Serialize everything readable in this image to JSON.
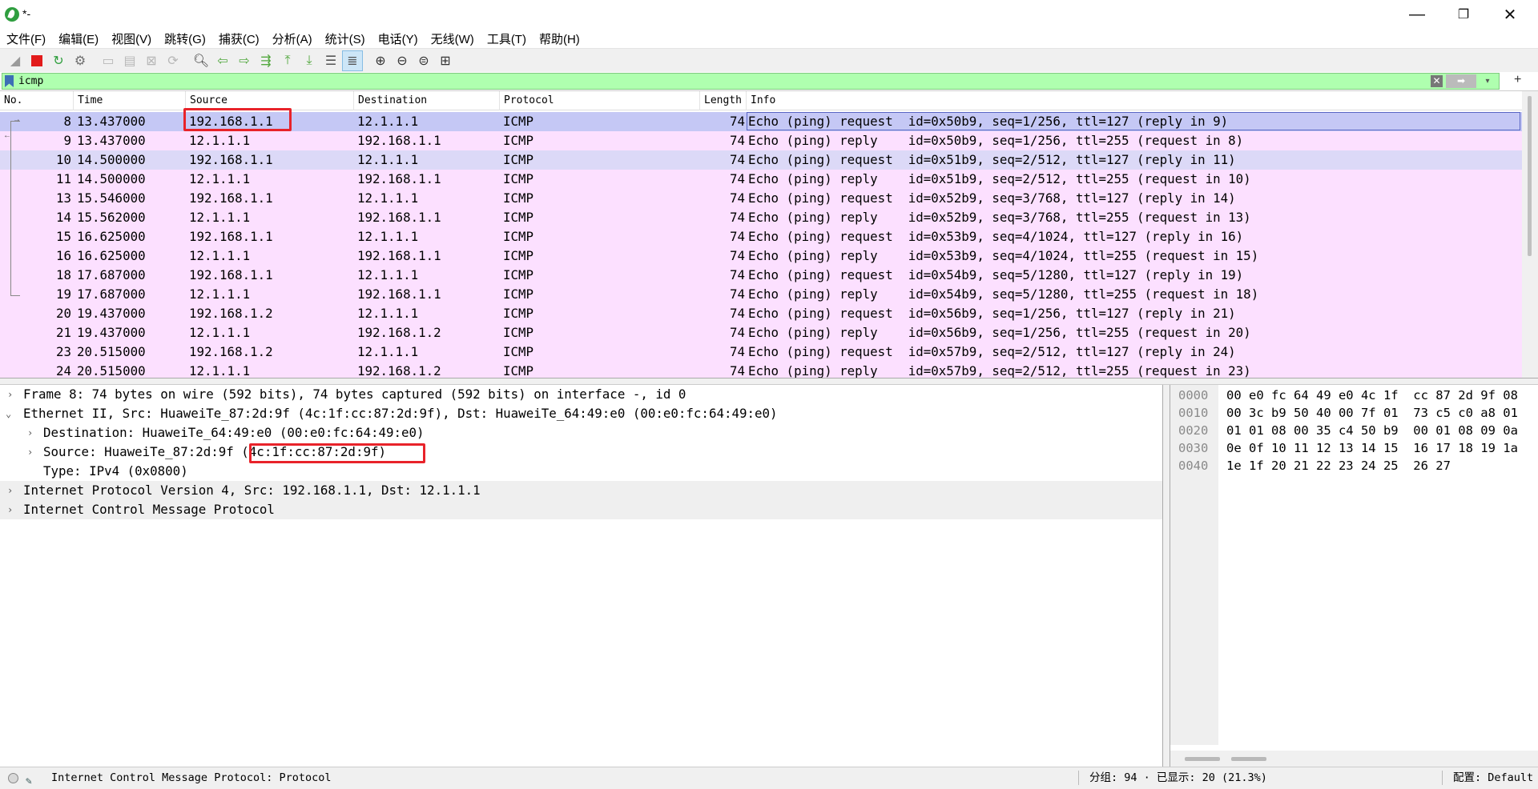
{
  "window": {
    "title": "*-",
    "minimize_glyph": "—",
    "maximize_glyph": "❐",
    "close_glyph": "✕"
  },
  "menu": [
    "文件(F)",
    "编辑(E)",
    "视图(V)",
    "跳转(G)",
    "捕获(C)",
    "分析(A)",
    "统计(S)",
    "电话(Y)",
    "无线(W)",
    "工具(T)",
    "帮助(H)"
  ],
  "toolbar": {
    "icons": [
      "shark-start-icon",
      "stop-capture-icon",
      "restart-capture-icon",
      "capture-options-icon",
      "open-file-icon",
      "save-file-icon",
      "close-file-icon",
      "reload-file-icon",
      "find-packet-icon",
      "go-back-icon",
      "go-forward-icon",
      "go-to-packet-icon",
      "go-first-icon",
      "go-last-icon",
      "autoscroll-icon",
      "colorize-icon",
      "zoom-in-icon",
      "zoom-out-icon",
      "zoom-normal-icon",
      "resize-columns-icon"
    ]
  },
  "filter": {
    "value": "icmp",
    "clear_glyph": "✕",
    "apply_glyph": "➡",
    "dropdown_glyph": "▾",
    "add_glyph": "+"
  },
  "packet_list": {
    "columns": [
      "No.",
      "Time",
      "Source",
      "Destination",
      "Protocol",
      "Length",
      "Info"
    ],
    "rows": [
      {
        "no": "8",
        "time": "13.437000",
        "source": "192.168.1.1",
        "destination": "12.1.1.1",
        "protocol": "ICMP",
        "length": "74",
        "info": "Echo (ping) request  id=0x50b9, seq=1/256, ttl=127 (reply in 9)"
      },
      {
        "no": "9",
        "time": "13.437000",
        "source": "12.1.1.1",
        "destination": "192.168.1.1",
        "protocol": "ICMP",
        "length": "74",
        "info": "Echo (ping) reply    id=0x50b9, seq=1/256, ttl=255 (request in 8)"
      },
      {
        "no": "10",
        "time": "14.500000",
        "source": "192.168.1.1",
        "destination": "12.1.1.1",
        "protocol": "ICMP",
        "length": "74",
        "info": "Echo (ping) request  id=0x51b9, seq=2/512, ttl=127 (reply in 11)"
      },
      {
        "no": "11",
        "time": "14.500000",
        "source": "12.1.1.1",
        "destination": "192.168.1.1",
        "protocol": "ICMP",
        "length": "74",
        "info": "Echo (ping) reply    id=0x51b9, seq=2/512, ttl=255 (request in 10)"
      },
      {
        "no": "13",
        "time": "15.546000",
        "source": "192.168.1.1",
        "destination": "12.1.1.1",
        "protocol": "ICMP",
        "length": "74",
        "info": "Echo (ping) request  id=0x52b9, seq=3/768, ttl=127 (reply in 14)"
      },
      {
        "no": "14",
        "time": "15.562000",
        "source": "12.1.1.1",
        "destination": "192.168.1.1",
        "protocol": "ICMP",
        "length": "74",
        "info": "Echo (ping) reply    id=0x52b9, seq=3/768, ttl=255 (request in 13)"
      },
      {
        "no": "15",
        "time": "16.625000",
        "source": "192.168.1.1",
        "destination": "12.1.1.1",
        "protocol": "ICMP",
        "length": "74",
        "info": "Echo (ping) request  id=0x53b9, seq=4/1024, ttl=127 (reply in 16)"
      },
      {
        "no": "16",
        "time": "16.625000",
        "source": "12.1.1.1",
        "destination": "192.168.1.1",
        "protocol": "ICMP",
        "length": "74",
        "info": "Echo (ping) reply    id=0x53b9, seq=4/1024, ttl=255 (request in 15)"
      },
      {
        "no": "18",
        "time": "17.687000",
        "source": "192.168.1.1",
        "destination": "12.1.1.1",
        "protocol": "ICMP",
        "length": "74",
        "info": "Echo (ping) request  id=0x54b9, seq=5/1280, ttl=127 (reply in 19)"
      },
      {
        "no": "19",
        "time": "17.687000",
        "source": "12.1.1.1",
        "destination": "192.168.1.1",
        "protocol": "ICMP",
        "length": "74",
        "info": "Echo (ping) reply    id=0x54b9, seq=5/1280, ttl=255 (request in 18)"
      },
      {
        "no": "20",
        "time": "19.437000",
        "source": "192.168.1.2",
        "destination": "12.1.1.1",
        "protocol": "ICMP",
        "length": "74",
        "info": "Echo (ping) request  id=0x56b9, seq=1/256, ttl=127 (reply in 21)"
      },
      {
        "no": "21",
        "time": "19.437000",
        "source": "12.1.1.1",
        "destination": "192.168.1.2",
        "protocol": "ICMP",
        "length": "74",
        "info": "Echo (ping) reply    id=0x56b9, seq=1/256, ttl=255 (request in 20)"
      },
      {
        "no": "23",
        "time": "20.515000",
        "source": "192.168.1.2",
        "destination": "12.1.1.1",
        "protocol": "ICMP",
        "length": "74",
        "info": "Echo (ping) request  id=0x57b9, seq=2/512, ttl=127 (reply in 24)"
      },
      {
        "no": "24",
        "time": "20.515000",
        "source": "12.1.1.1",
        "destination": "192.168.1.2",
        "protocol": "ICMP",
        "length": "74",
        "info": "Echo (ping) reply    id=0x57b9, seq=2/512, ttl=255 (request in 23)"
      }
    ]
  },
  "details": {
    "frame": "Frame 8: 74 bytes on wire (592 bits), 74 bytes captured (592 bits) on interface -, id 0",
    "ethernet": "Ethernet II, Src: HuaweiTe_87:2d:9f (4c:1f:cc:87:2d:9f), Dst: HuaweiTe_64:49:e0 (00:e0:fc:64:49:e0)",
    "eth_destination": "Destination: HuaweiTe_64:49:e0 (00:e0:fc:64:49:e0)",
    "eth_source_prefix": "Source: HuaweiTe_87:2d:9f ",
    "eth_source_mac": "(4c:1f:cc:87:2d:9f)",
    "eth_type": "Type: IPv4 (0x0800)",
    "ip": "Internet Protocol Version 4, Src: 192.168.1.1, Dst: 12.1.1.1",
    "icmp": "Internet Control Message Protocol",
    "toggle_collapsed": "›",
    "toggle_expanded": "⌄"
  },
  "bytes": {
    "rows": [
      {
        "offset": "0000",
        "hex": "00 e0 fc 64 49 e0 4c 1f  cc 87 2d 9f 08"
      },
      {
        "offset": "0010",
        "hex": "00 3c b9 50 40 00 7f 01  73 c5 c0 a8 01"
      },
      {
        "offset": "0020",
        "hex": "01 01 08 00 35 c4 50 b9  00 01 08 09 0a"
      },
      {
        "offset": "0030",
        "hex": "0e 0f 10 11 12 13 14 15  16 17 18 19 1a"
      },
      {
        "offset": "0040",
        "hex": "1e 1f 20 21 22 23 24 25  26 27"
      }
    ]
  },
  "status": {
    "text": "Internet Control Message Protocol: Protocol",
    "packets": "分组: 94 · 已显示: 20 (21.3%)",
    "profile": "配置: Default"
  },
  "colors": {
    "row_bg": "#fce0ff",
    "selected_row_bg": "#c5c8f5",
    "filter_bg": "#afffaf",
    "highlight": "#e8232a"
  }
}
